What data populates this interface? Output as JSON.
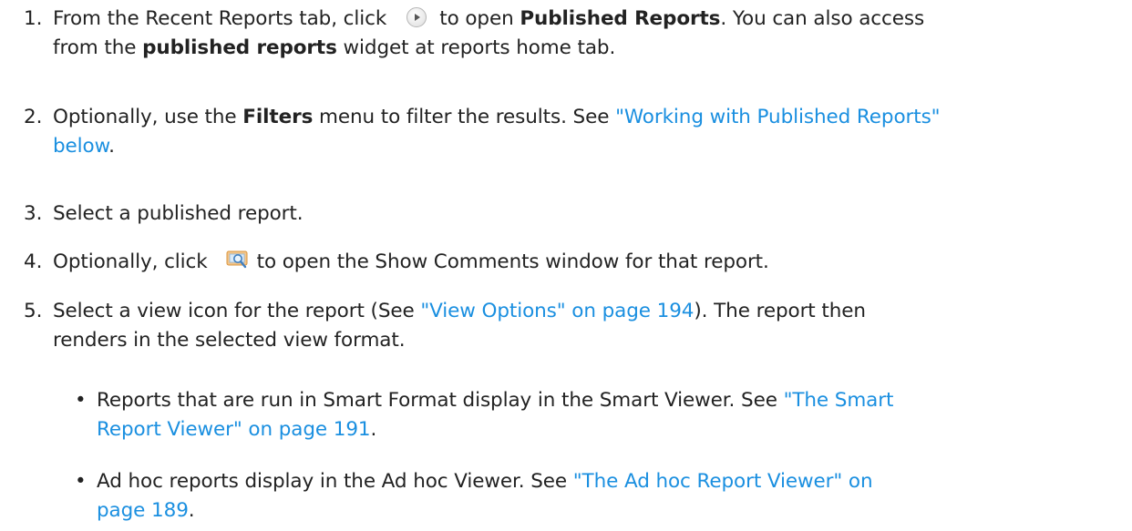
{
  "steps": [
    {
      "num": "1.",
      "l1_a": "From the Recent Reports tab, click",
      "l1_b": "to open",
      "l1_bold": "Published Reports",
      "l1_c": ". You can also access",
      "l2_a": "from the",
      "l2_bold": "published reports",
      "l2_b": "widget at reports home tab."
    },
    {
      "num": "2.",
      "l1_a": "Optionally, use the",
      "l1_bold": "Filters",
      "l1_b": "menu to filter the results. See",
      "l1_link": "\"Working with Published Reports\"",
      "l2_link": "below",
      "l2_end": "."
    },
    {
      "num": "3.",
      "l1": "Select a published report."
    },
    {
      "num": "4.",
      "l1_a": "Optionally, click",
      "l1_b": "to open the Show Comments window for that report."
    },
    {
      "num": "5.",
      "l1_a": "Select a view icon for the report (See",
      "l1_link": "\"View Options\" on page 194",
      "l1_b": "). The report then",
      "l2": "renders in the selected view format."
    }
  ],
  "bullets": [
    {
      "dot": "•",
      "l1_a": "Reports that are run in Smart Format display in the Smart Viewer. See",
      "l1_link": "\"The Smart",
      "l2_link": "Report Viewer\" on page 191",
      "l2_end": "."
    },
    {
      "dot": "•",
      "l1_a": "Ad hoc reports display in the Ad hoc Viewer. See",
      "l1_link": "\"The Ad hoc Report Viewer\" on",
      "l2_link": "page 189",
      "l2_end": "."
    }
  ],
  "icons": {
    "open_published": "play-circle-icon",
    "show_comments": "comment-magnifier-icon"
  },
  "colors": {
    "link": "#1a8fe0",
    "text": "#222222"
  }
}
